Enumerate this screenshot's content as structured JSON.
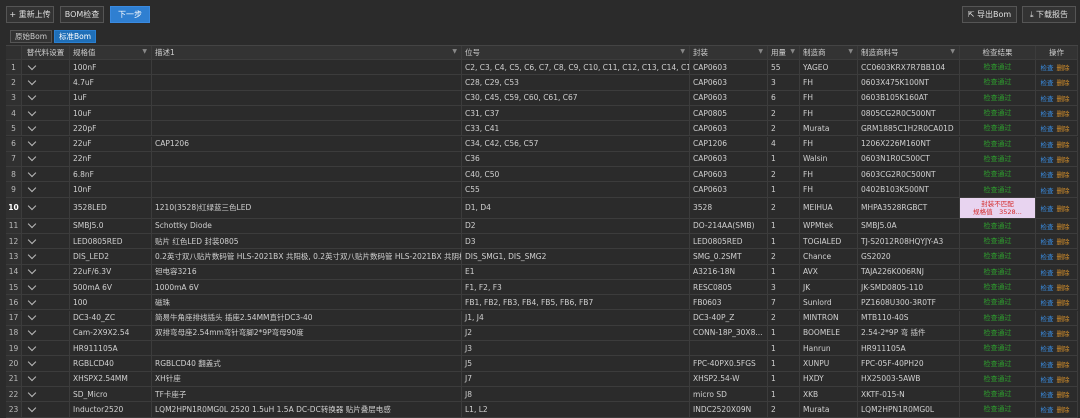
{
  "toolbar": {
    "reupload": "+ 重新上传",
    "bom_check": "BOM检查",
    "next_step": "下一步",
    "export_bom": "导出Bom",
    "download_report": "下载报告"
  },
  "tabs": [
    "原始Bom",
    "标准Bom"
  ],
  "columns": [
    "替代料设置",
    "规格值",
    "描述1",
    "位号",
    "封装",
    "用量",
    "制造商",
    "制造商料号",
    "检查结果",
    "操作"
  ],
  "ops": {
    "check": "检查",
    "delete": "删除"
  },
  "result_ok": "检查通过",
  "rows": [
    {
      "n": "1",
      "spec": "100nF",
      "desc": "",
      "ref": "C2, C3, C4, C5, C6, C7, C8, C9, C10, C11, C12, C13, C14, C15, ...",
      "pkg": "CAP0603",
      "qty": "55",
      "mfr": "YAGEO",
      "pn": "CC0603KRX7R7BB104",
      "result": "ok"
    },
    {
      "n": "2",
      "spec": "4.7uF",
      "desc": "",
      "ref": "C28, C29, C53",
      "pkg": "CAP0603",
      "qty": "3",
      "mfr": "FH",
      "pn": "0603X475K100NT",
      "result": "ok"
    },
    {
      "n": "3",
      "spec": "1uF",
      "desc": "",
      "ref": "C30, C45, C59, C60, C61, C67",
      "pkg": "CAP0603",
      "qty": "6",
      "mfr": "FH",
      "pn": "0603B105K160AT",
      "result": "ok"
    },
    {
      "n": "4",
      "spec": "10uF",
      "desc": "",
      "ref": "C31, C37",
      "pkg": "CAP0805",
      "qty": "2",
      "mfr": "FH",
      "pn": "0805CG2R0C500NT",
      "result": "ok"
    },
    {
      "n": "5",
      "spec": "220pF",
      "desc": "",
      "ref": "C33, C41",
      "pkg": "CAP0603",
      "qty": "2",
      "mfr": "Murata",
      "pn": "GRM1885C1H2R0CA01D",
      "result": "ok"
    },
    {
      "n": "6",
      "spec": "22uF",
      "desc": "CAP1206",
      "ref": "C34, C42, C56, C57",
      "pkg": "CAP1206",
      "qty": "4",
      "mfr": "FH",
      "pn": "1206X226M160NT",
      "result": "ok"
    },
    {
      "n": "7",
      "spec": "22nF",
      "desc": "",
      "ref": "C36",
      "pkg": "CAP0603",
      "qty": "1",
      "mfr": "Walsin",
      "pn": "0603N1R0C500CT",
      "result": "ok"
    },
    {
      "n": "8",
      "spec": "6.8nF",
      "desc": "",
      "ref": "C40, C50",
      "pkg": "CAP0603",
      "qty": "2",
      "mfr": "FH",
      "pn": "0603CG2R0C500NT",
      "result": "ok"
    },
    {
      "n": "9",
      "spec": "10nF",
      "desc": "",
      "ref": "C55",
      "pkg": "CAP0603",
      "qty": "1",
      "mfr": "FH",
      "pn": "0402B103K500NT",
      "result": "ok"
    },
    {
      "n": "10",
      "spec": "3528LED",
      "desc": "1210(3528)红绿蓝三色LED",
      "ref": "D1, D4",
      "pkg": "3528",
      "qty": "2",
      "mfr": "MEIHUA",
      "pn": "MHPA3528RGBCT",
      "result": "bad",
      "bad1": "封装不匹配",
      "bad2": "规格值　3528..."
    },
    {
      "n": "11",
      "spec": "SMBJ5.0",
      "desc": "Schottky Diode",
      "ref": "D2",
      "pkg": "DO-214AA(SMB)",
      "qty": "1",
      "mfr": "WPMtek",
      "pn": "SMBJ5.0A",
      "result": "ok"
    },
    {
      "n": "12",
      "spec": "LED0805RED",
      "desc": "贴片 红色LED 封装0805",
      "ref": "D3",
      "pkg": "LED0805RED",
      "qty": "1",
      "mfr": "TOGIALED",
      "pn": "TJ-S2012R08HQYJY-A3",
      "result": "ok"
    },
    {
      "n": "13",
      "spec": "DIS_LED2",
      "desc": "0.2英寸双八贴片数码管 HLS-2021BX 共阳极, 0.2英寸双八贴片数码管 HLS-2021BX 共阴极",
      "ref": "DIS_SMG1, DIS_SMG2",
      "pkg": "SMG_0.2SMT",
      "qty": "2",
      "mfr": "Chance",
      "pn": "GS2020",
      "result": "ok"
    },
    {
      "n": "14",
      "spec": "22uF/6.3V",
      "desc": "钽电容3216",
      "ref": "E1",
      "pkg": "A3216-18N",
      "qty": "1",
      "mfr": "AVX",
      "pn": "TAJA226K006RNJ",
      "result": "ok"
    },
    {
      "n": "15",
      "spec": "500mA 6V",
      "desc": "1000mA 6V",
      "ref": "F1, F2, F3",
      "pkg": "RESC0805",
      "qty": "3",
      "mfr": "JK",
      "pn": "JK-SMD0805-110",
      "result": "ok"
    },
    {
      "n": "16",
      "spec": "100",
      "desc": "磁珠",
      "ref": "FB1, FB2, FB3, FB4, FB5, FB6, FB7",
      "pkg": "FB0603",
      "qty": "7",
      "mfr": "Sunlord",
      "pn": "PZ1608U300-3R0TF",
      "result": "ok"
    },
    {
      "n": "17",
      "spec": "DC3-40_ZC",
      "desc": "简易牛角座排线插头 插座2.54MM直针DC3-40",
      "ref": "J1, J4",
      "pkg": "DC3-40P_Z",
      "qty": "2",
      "mfr": "MINTRON",
      "pn": "MTB110-40S",
      "result": "ok"
    },
    {
      "n": "18",
      "spec": "Cam-2X9X2.54",
      "desc": "双排弯母座2.54mm弯针弯脚2*9P弯母90度",
      "ref": "J2",
      "pkg": "CONN-18P_30X8...",
      "qty": "1",
      "mfr": "BOOMELE",
      "pn": "2.54-2*9P 弯 插件",
      "result": "ok"
    },
    {
      "n": "19",
      "spec": "HR911105A",
      "desc": "",
      "ref": "J3",
      "pkg": "",
      "qty": "1",
      "mfr": "Hanrun",
      "pn": "HR911105A",
      "result": "ok"
    },
    {
      "n": "20",
      "spec": "RGBLCD40",
      "desc": "RGBLCD40 翻盖式",
      "ref": "J5",
      "pkg": "FPC-40PX0.5FGS",
      "qty": "1",
      "mfr": "XUNPU",
      "pn": "FPC-05F-40PH20",
      "result": "ok"
    },
    {
      "n": "21",
      "spec": "XHSPX2.54MM",
      "desc": "XH针座",
      "ref": "J7",
      "pkg": "XHSP2.54-W",
      "qty": "1",
      "mfr": "HXDY",
      "pn": "HX25003-5AWB",
      "result": "ok"
    },
    {
      "n": "22",
      "spec": "SD_Micro",
      "desc": "TF卡座子",
      "ref": "J8",
      "pkg": "micro SD",
      "qty": "1",
      "mfr": "XKB",
      "pn": "XKTF-015-N",
      "result": "ok"
    },
    {
      "n": "23",
      "spec": "Inductor2520",
      "desc": "LQM2HPN1R0MG0L 2520 1.5uH 1.5A DC-DC转换器 贴片叠层电感",
      "ref": "L1, L2",
      "pkg": "INDC2520X09N",
      "qty": "2",
      "mfr": "Murata",
      "pn": "LQM2HPN1R0MG0L",
      "result": "ok"
    }
  ]
}
